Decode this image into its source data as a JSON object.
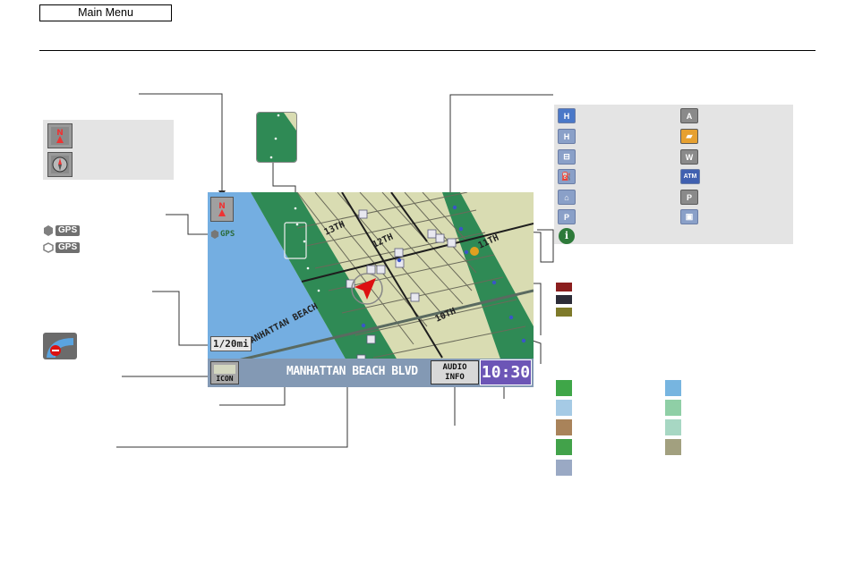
{
  "header": {
    "main_menu_label": "Main Menu"
  },
  "map": {
    "street_names": [
      "13TH",
      "12TH",
      "11TH",
      "10TH",
      "MANHATTAN BEACH"
    ],
    "scale_label": "1/20mi",
    "icon_button_label": "ICON",
    "current_street": "MANHATTAN BEACH BLVD",
    "audio_info_line1": "AUDIO",
    "audio_info_line2": "INFO",
    "clock": "10:30",
    "gps_badge": "GPS"
  },
  "legend": {
    "gps_badges": [
      "GPS",
      "GPS"
    ],
    "poi_atm_label": "ATM",
    "traffic_colors": [
      "#8b1e1e",
      "#2c2c38",
      "#7e7a2a"
    ],
    "area_colors": [
      "#3fa648",
      "#77b5e0",
      "#a5cae5",
      "#8fcfa6",
      "#a9835a",
      "#a7d7c3",
      "#42a24a",
      "#a2a07f",
      "#9aa9c4"
    ]
  },
  "colors": {
    "ocean": "#74aee1",
    "land": "#d9dcb2",
    "park": "#2f8a55",
    "clock_bg": "#6c55b6",
    "map_bar": "#8399b4"
  }
}
